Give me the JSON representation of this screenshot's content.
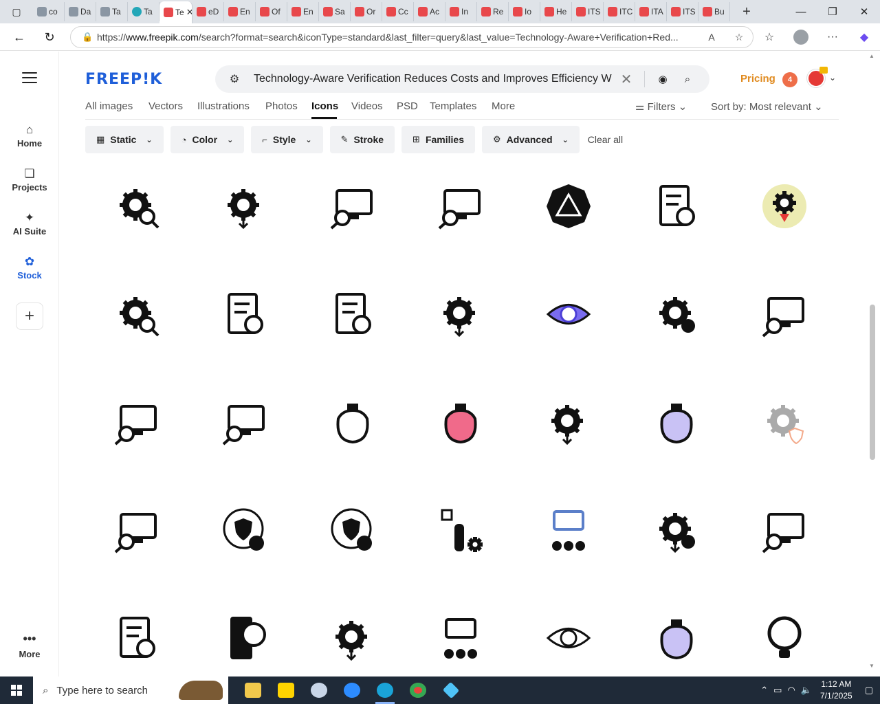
{
  "browser": {
    "tabs": [
      {
        "label": "co",
        "favicon": "grey"
      },
      {
        "label": "Da",
        "favicon": "grey"
      },
      {
        "label": "Ta",
        "favicon": "grey"
      },
      {
        "label": "Ta",
        "favicon": "teal"
      },
      {
        "label": "Te",
        "favicon": "red",
        "active": true
      },
      {
        "label": "eD",
        "favicon": "red"
      },
      {
        "label": "En",
        "favicon": "red"
      },
      {
        "label": "Of",
        "favicon": "red"
      },
      {
        "label": "En",
        "favicon": "red"
      },
      {
        "label": "Sa",
        "favicon": "red"
      },
      {
        "label": "Or",
        "favicon": "red"
      },
      {
        "label": "Cc",
        "favicon": "red"
      },
      {
        "label": "Ac",
        "favicon": "red"
      },
      {
        "label": "In",
        "favicon": "red"
      },
      {
        "label": "Re",
        "favicon": "red"
      },
      {
        "label": "Io",
        "favicon": "red"
      },
      {
        "label": "He",
        "favicon": "red"
      },
      {
        "label": "ITS",
        "favicon": "red"
      },
      {
        "label": "ITC",
        "favicon": "red"
      },
      {
        "label": "ITA",
        "favicon": "red"
      },
      {
        "label": "ITS",
        "favicon": "red"
      },
      {
        "label": "Bu",
        "favicon": "red"
      }
    ],
    "url_prefix": "https://",
    "url_host": "www.freepik.com",
    "url_rest": "/search?format=search&iconType=standard&last_filter=query&last_value=Technology-Aware+Verification+Red..."
  },
  "sidebar": {
    "items": [
      {
        "label": "Home",
        "icon": "home-icon"
      },
      {
        "label": "Projects",
        "icon": "projects-icon"
      },
      {
        "label": "AI Suite",
        "icon": "sparkle-icon"
      },
      {
        "label": "Stock",
        "icon": "stock-icon",
        "active": true
      }
    ],
    "more_label": "More"
  },
  "header": {
    "logo": "FREEP!K",
    "search_value": "Technology-Aware Verification Reduces Costs and Improves Efficiency W",
    "pricing_label": "Pricing",
    "notification_count": "4"
  },
  "category_tabs": [
    {
      "label": "All images"
    },
    {
      "label": "Vectors"
    },
    {
      "label": "Illustrations"
    },
    {
      "label": "Photos"
    },
    {
      "label": "Icons",
      "active": true
    },
    {
      "label": "Videos"
    },
    {
      "label": "PSD"
    },
    {
      "label": "Templates"
    },
    {
      "label": "More"
    }
  ],
  "sort": {
    "filters_label": "Filters",
    "sort_label": "Sort by:",
    "sort_value": "Most relevant"
  },
  "filters": [
    {
      "label": "Static",
      "icon": "static-icon",
      "dropdown": true
    },
    {
      "label": "Color",
      "icon": "palette-icon",
      "dropdown": true
    },
    {
      "label": "Style",
      "icon": "brush-icon",
      "dropdown": true
    },
    {
      "label": "Stroke",
      "icon": "pen-icon",
      "dropdown": false
    },
    {
      "label": "Families",
      "icon": "grid-icon",
      "dropdown": false
    },
    {
      "label": "Advanced",
      "icon": "gear-icon",
      "dropdown": true
    }
  ],
  "clear_all_label": "Clear all",
  "icons": [
    [
      "dollar-magnifier-gear",
      "dollar-gear-arrow",
      "laptop-gear-magnifier",
      "monitor-gear-magnifier",
      "octagon-warning-dollar",
      "gear-checklist-dollar",
      "gear-dollar-badge-color"
    ],
    [
      "gears-magnifier-dollar",
      "checklist-magnifier-cash",
      "checklist-magnifier-cash-alt",
      "gear-bitcoin-arrows",
      "eye-dollar-color",
      "gear-dollar-check",
      "monitor-bag-magnifier"
    ],
    [
      "monitor-gear-magnifier-cash",
      "laptop-bag-magnifier",
      "money-bag-warning",
      "briefcase-gear-color",
      "gear-dollar-arrows",
      "bag-dollar-color",
      "gear-shield-outline"
    ],
    [
      "monitor-dollar-gear",
      "clock-shield-coin",
      "clock-shield-coin-alt",
      "hand-bitcoin-gear",
      "server-dollar-check",
      "gear-check-arrows",
      "monitor-bag-magnifier-alt"
    ],
    [
      "document-dollar-gear",
      "phone-bitcoin-check",
      "gear-dollar-down",
      "cash-network",
      "gear-eye",
      "bag-dollar-arrows-color",
      "bulb-dollar-check"
    ]
  ],
  "taskbar": {
    "search_placeholder": "Type here to search",
    "time": "1:12 AM",
    "date": "7/1/2025"
  }
}
